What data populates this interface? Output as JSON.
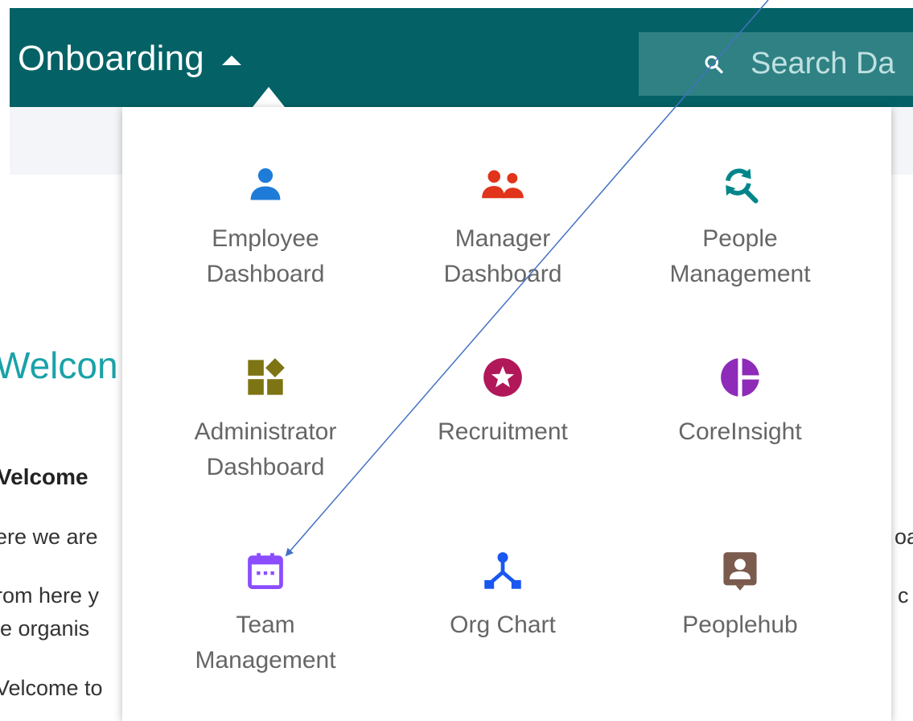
{
  "header": {
    "app_title": "Onboarding",
    "search_placeholder": "Search Da"
  },
  "page": {
    "heading": "Welcon",
    "subheading": "Velcome",
    "lines_left": [
      "ere we are",
      "rom here y",
      "ie organis",
      "Velcome to"
    ],
    "lines_right": [
      "oa",
      "c"
    ]
  },
  "apps": [
    {
      "label": "Employee\nDashboard",
      "icon": "person-icon",
      "color": "#1e7bd8"
    },
    {
      "label": "Manager\nDashboard",
      "icon": "people-icon",
      "color": "#e0341b"
    },
    {
      "label": "People\nManagement",
      "icon": "refresh-search-icon",
      "color": "#00868a"
    },
    {
      "label": "Administrator\nDashboard",
      "icon": "widgets-icon",
      "color": "#7d7413"
    },
    {
      "label": "Recruitment",
      "icon": "star-circle-icon",
      "color": "#b0185a"
    },
    {
      "label": "CoreInsight",
      "icon": "pie-chart-icon",
      "color": "#8e2bb8"
    },
    {
      "label": "Team\nManagement",
      "icon": "calendar-icon",
      "color": "#8a4dff"
    },
    {
      "label": "Org Chart",
      "icon": "org-chart-icon",
      "color": "#1a56f0"
    },
    {
      "label": "Peoplehub",
      "icon": "contact-card-icon",
      "color": "#7a5b4e"
    }
  ],
  "annotation": {
    "arrow_color": "#4472c4"
  }
}
